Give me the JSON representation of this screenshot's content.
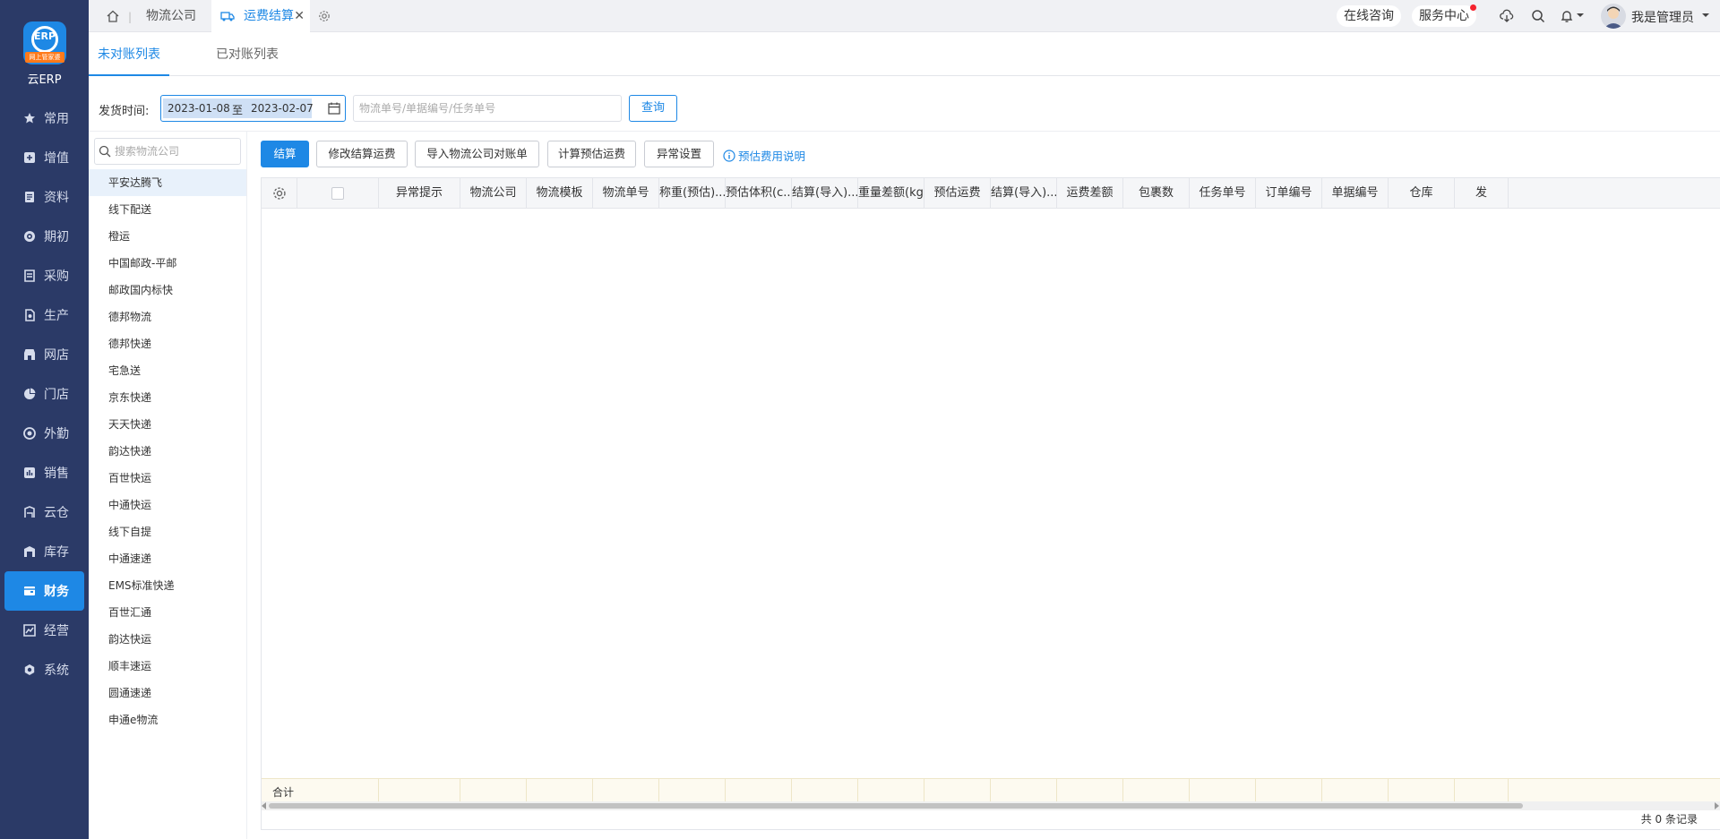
{
  "app": {
    "logo_text": "ERP",
    "logo_ribbon": "网上管家婆",
    "name": "云ERP"
  },
  "sidebar": {
    "items": [
      {
        "label": "常用",
        "icon": "star-icon"
      },
      {
        "label": "增值",
        "icon": "plus-square-icon"
      },
      {
        "label": "资料",
        "icon": "document-icon"
      },
      {
        "label": "期初",
        "icon": "target-icon"
      },
      {
        "label": "采购",
        "icon": "purchase-icon"
      },
      {
        "label": "生产",
        "icon": "production-icon"
      },
      {
        "label": "网店",
        "icon": "store-icon"
      },
      {
        "label": "门店",
        "icon": "pie-chart-icon"
      },
      {
        "label": "外勤",
        "icon": "field-icon"
      },
      {
        "label": "销售",
        "icon": "bar-chart-icon"
      },
      {
        "label": "云仓",
        "icon": "cloud-warehouse-icon"
      },
      {
        "label": "库存",
        "icon": "inventory-icon"
      },
      {
        "label": "财务",
        "icon": "finance-icon",
        "active": true
      },
      {
        "label": "经营",
        "icon": "business-icon"
      },
      {
        "label": "系统",
        "icon": "system-icon"
      }
    ]
  },
  "topbar": {
    "tabs": [
      {
        "label": "物流公司"
      },
      {
        "label": "运费结算",
        "active": true
      }
    ],
    "tab_close": "✕",
    "separator": "|",
    "online_consult": "在线咨询",
    "service_center": "服务中心",
    "user_name": "我是管理员"
  },
  "subtabs": [
    {
      "label": "未对账列表",
      "active": true
    },
    {
      "label": "已对账列表"
    }
  ],
  "filter": {
    "label": "发货时间:",
    "date_start": "2023-01-08",
    "date_to": "至",
    "date_end": "2023-02-07",
    "search_placeholder": "物流单号/单据编号/任务单号",
    "query_label": "查询"
  },
  "company_search_placeholder": "搜索物流公司",
  "companies": [
    "平安达腾飞",
    "线下配送",
    "橙运",
    "中国邮政-平邮",
    "邮政国内标快",
    "德邦物流",
    "德邦快递",
    "宅急送",
    "京东快递",
    "天天快递",
    "韵达快递",
    "百世快运",
    "中通快运",
    "线下自提",
    "中通速递",
    "EMS标准快递",
    "百世汇通",
    "韵达快运",
    "顺丰速运",
    "圆通速递",
    "申通e物流"
  ],
  "toolbar": {
    "settle": "结算",
    "modify_freight": "修改结算运费",
    "import_bill": "导入物流公司对账单",
    "calc_freight": "计算预估运费",
    "abnormal_settings": "异常设置",
    "help_link": "预估费用说明"
  },
  "table": {
    "columns": [
      "异常提示",
      "物流公司",
      "物流模板",
      "物流单号",
      "称重(预估)...",
      "预估体积(c...",
      "结算(导入)...",
      "重量差额(kg)",
      "预估运费",
      "结算(导入)...",
      "运费差额",
      "包裹数",
      "任务单号",
      "订单编号",
      "单据编号",
      "仓库",
      "发"
    ],
    "total_label": "合计",
    "records": "共 0 条记录"
  },
  "colors": {
    "sidebar_bg": "#2b3a67",
    "accent": "#1e88e5",
    "notification": "#f5222d"
  }
}
